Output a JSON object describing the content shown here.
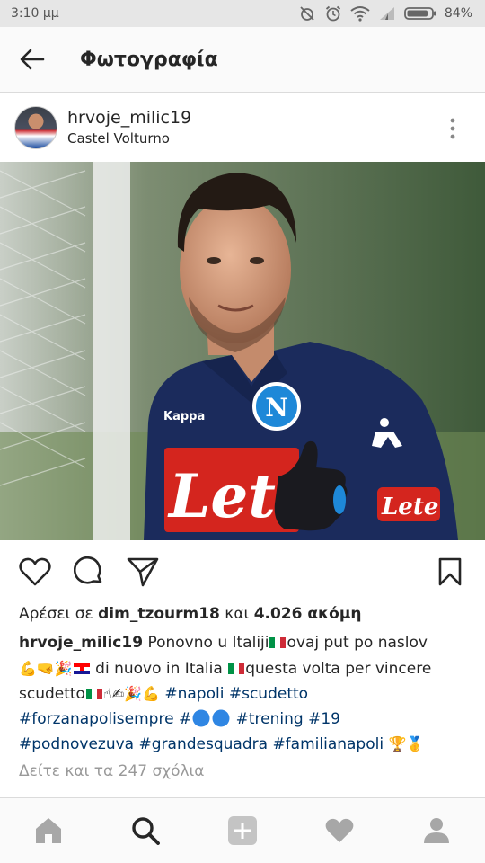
{
  "status_bar": {
    "time": "3:10 μμ",
    "battery": "84%"
  },
  "app_bar": {
    "title": "Φωτογραφία"
  },
  "post": {
    "username": "hrvoje_milic19",
    "location": "Castel Volturno",
    "likes": {
      "prefix": "Αρέσει σε",
      "user": "dim_tzourm18",
      "connector": "και",
      "count": "4.026 ακόμη"
    },
    "caption": {
      "username": "hrvoje_milic19",
      "text_1": "Ponovno u Italiji",
      "text_2": "ovaj put po naslov",
      "text_3": "di nuovo in Italia",
      "text_4": "questa volta per vincere scudetto",
      "hashtags_1": [
        "#napoli",
        "#scudetto"
      ],
      "hashtags_2": [
        "#forzanapolisempre",
        "#",
        "#trening",
        "#19"
      ],
      "hashtags_3": [
        "#podnovezuva",
        "#grandesquadra",
        "#familianapoli"
      ]
    },
    "view_comments": "Δείτε και τα 247 σχόλια"
  },
  "photo": {
    "jacket_sponsor": "Lete",
    "jacket_brand": "Kappa",
    "badge_letter": "N"
  },
  "colors": {
    "hashtag": "#003569",
    "muted": "#999999",
    "status_bar": "#e6e6e6",
    "app_bar": "#fafafa"
  },
  "icons": [
    "back-arrow-icon",
    "more-vertical-icon",
    "heart-icon",
    "comment-icon",
    "share-icon",
    "bookmark-icon",
    "home-icon",
    "search-icon",
    "add-icon",
    "activity-heart-icon",
    "profile-icon"
  ]
}
